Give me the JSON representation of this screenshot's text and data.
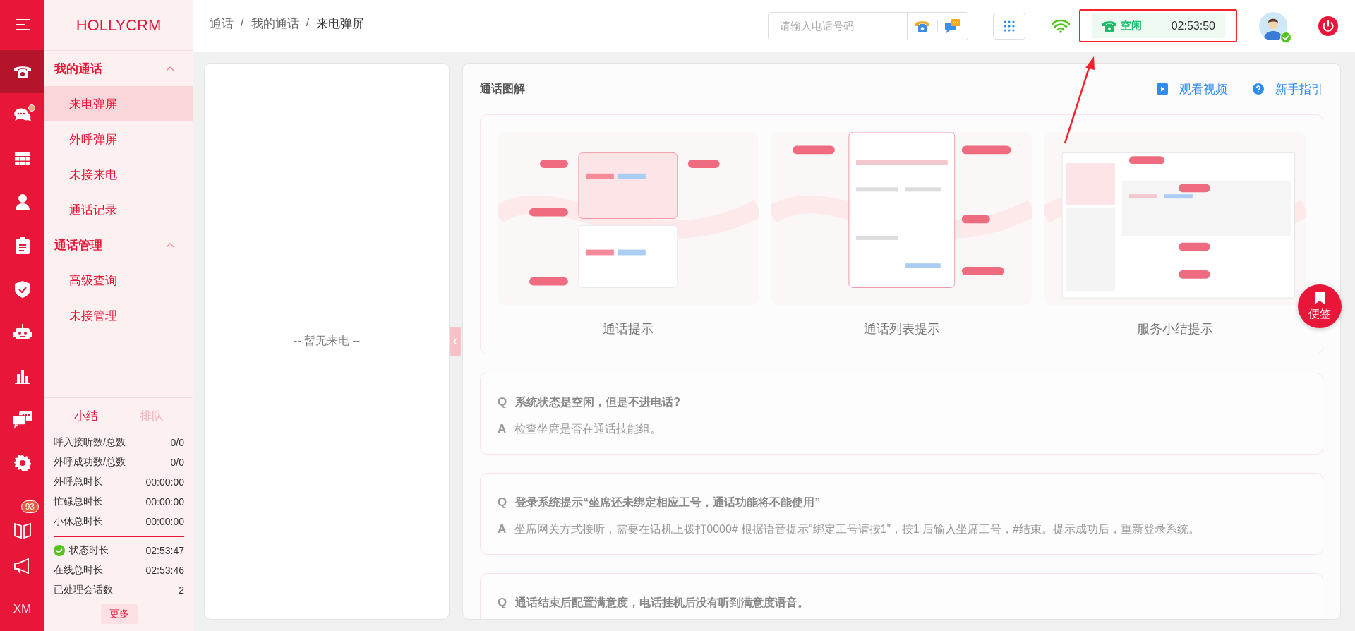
{
  "logo": "HOLLYCRM",
  "rail": [
    {
      "kind": "menu",
      "selected": false,
      "dot": false
    },
    {
      "kind": "phone",
      "selected": true,
      "dot": false
    },
    {
      "kind": "chat",
      "selected": false,
      "dot": true
    },
    {
      "kind": "grid",
      "selected": false,
      "dot": false
    },
    {
      "kind": "person",
      "selected": false,
      "dot": false
    },
    {
      "kind": "clipboard",
      "selected": false,
      "dot": false
    },
    {
      "kind": "shield",
      "selected": false,
      "dot": false
    },
    {
      "kind": "robot",
      "selected": false,
      "dot": false
    },
    {
      "kind": "chart",
      "selected": false,
      "dot": false
    },
    {
      "kind": "chats",
      "selected": false,
      "dot": false
    },
    {
      "kind": "gear",
      "selected": false,
      "dot": false
    },
    {
      "kind": "book",
      "selected": false,
      "dot": false,
      "badge": "93"
    },
    {
      "kind": "megaphone",
      "selected": false,
      "dot": false
    },
    {
      "kind": "text",
      "selected": false,
      "dot": false,
      "label": "XM"
    }
  ],
  "menu_groups": [
    {
      "title": "我的通话",
      "expanded": true,
      "items": [
        {
          "label": "来电弹屏",
          "selected": true
        },
        {
          "label": "外呼弹屏",
          "selected": false
        },
        {
          "label": "未接来电",
          "selected": false
        },
        {
          "label": "通话记录",
          "selected": false
        }
      ]
    },
    {
      "title": "通话管理",
      "expanded": true,
      "items": [
        {
          "label": "高级查询",
          "selected": false
        },
        {
          "label": "未接管理",
          "selected": false
        }
      ]
    }
  ],
  "summary": {
    "tabs": [
      {
        "label": "小结",
        "selected": true
      },
      {
        "label": "排队",
        "selected": false
      }
    ],
    "stats": [
      {
        "label": "呼入接听数/总数",
        "value": "0/0"
      },
      {
        "label": "外呼成功数/总数",
        "value": "0/0"
      },
      {
        "label": "外呼总时长",
        "value": "00:00:00"
      },
      {
        "label": "忙碌总时长",
        "value": "00:00:00"
      },
      {
        "label": "小休总时长",
        "value": "00:00:00"
      }
    ],
    "stats2": [
      {
        "label": "状态时长",
        "value": "02:53:47",
        "ok": true
      },
      {
        "label": "在线总时长",
        "value": "02:53:46",
        "ok": false
      },
      {
        "label": "已处理会话数",
        "value": "2",
        "ok": false
      }
    ],
    "more_button": "更多"
  },
  "breadcrumb": [
    {
      "label": "通话"
    },
    {
      "label": "我的通话"
    },
    {
      "label": "来电弹屏"
    }
  ],
  "breadcrumb_separators": [
    "/",
    "/"
  ],
  "phone_input": {
    "placeholder": "请输入电话号码"
  },
  "status": {
    "label": "空闲",
    "timer": "02:53:50"
  },
  "user": {
    "online": true
  },
  "left_panel": {
    "empty_text": "-- 暂无来电 --"
  },
  "guide": {
    "title": "通话图解",
    "links": [
      {
        "label": "观看视频",
        "kind": "video"
      },
      {
        "label": "新手指引",
        "kind": "help"
      }
    ],
    "pictures": [
      {
        "kind": "picture",
        "caption": "通话提示"
      },
      {
        "kind": "picture",
        "caption": "通话列表提示"
      },
      {
        "kind": "picture",
        "caption": "服务小结提示"
      }
    ]
  },
  "faq": [
    {
      "q_mark": "Q",
      "question": "系统状态是空闲，但是不进电话?",
      "a_mark": "A",
      "answer": "检查坐席是否在通话技能组。"
    },
    {
      "q_mark": "Q",
      "question": "登录系统提示“坐席还未绑定相应工号，通话功能将不能使用”",
      "a_mark": "A",
      "answer": "坐席网关方式接听，需要在话机上拨打0000# 根据语音提示“绑定工号请按1”，按1 后输入坐席工号，#结束。提示成功后，重新登录系统。"
    },
    {
      "q_mark": "Q",
      "question": "通话结束后配置满意度，电话挂机后没有听到满意度语音。"
    }
  ],
  "sticky_note": "便签"
}
